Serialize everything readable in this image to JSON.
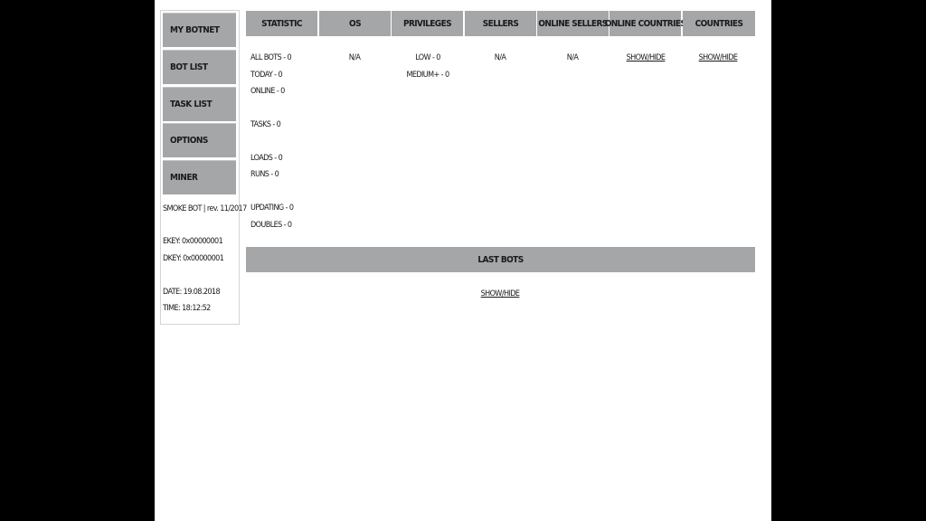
{
  "sidebar": {
    "menu": [
      "MY BOTNET",
      "BOT LIST",
      "TASK LIST",
      "OPTIONS",
      "MINER"
    ],
    "version": "SMOKE BOT | rev. 11/2017",
    "ekey": "EKEY: 0x00000001",
    "dkey": "DKEY: 0x00000001",
    "date": "DATE: 19.08.2018",
    "time": "TIME: 18:12:52"
  },
  "table": {
    "headers": [
      "STATISTIC",
      "OS",
      "PRIVILEGES",
      "SELLERS",
      "ONLINE SELLERS",
      "ONLINE COUNTRIES",
      "COUNTRIES"
    ],
    "statistic": {
      "all_bots": "ALL BOTS - 0",
      "today": "TODAY - 0",
      "online": "ONLINE - 0",
      "tasks": "TASKS - 0",
      "loads": "LOADS - 0",
      "runs": "RUNS - 0",
      "updating": "UPDATING - 0",
      "doubles": "DOUBLES - 0"
    },
    "os": "N/A",
    "privileges": {
      "low": "LOW - 0",
      "medium": "MEDIUM+ - 0"
    },
    "sellers": "N/A",
    "online_sellers": "N/A",
    "online_countries_link": "SHOW/HIDE",
    "countries_link": "SHOW/HIDE"
  },
  "last_bots": {
    "title": "LAST BOTS",
    "link": "SHOW/HIDE"
  }
}
